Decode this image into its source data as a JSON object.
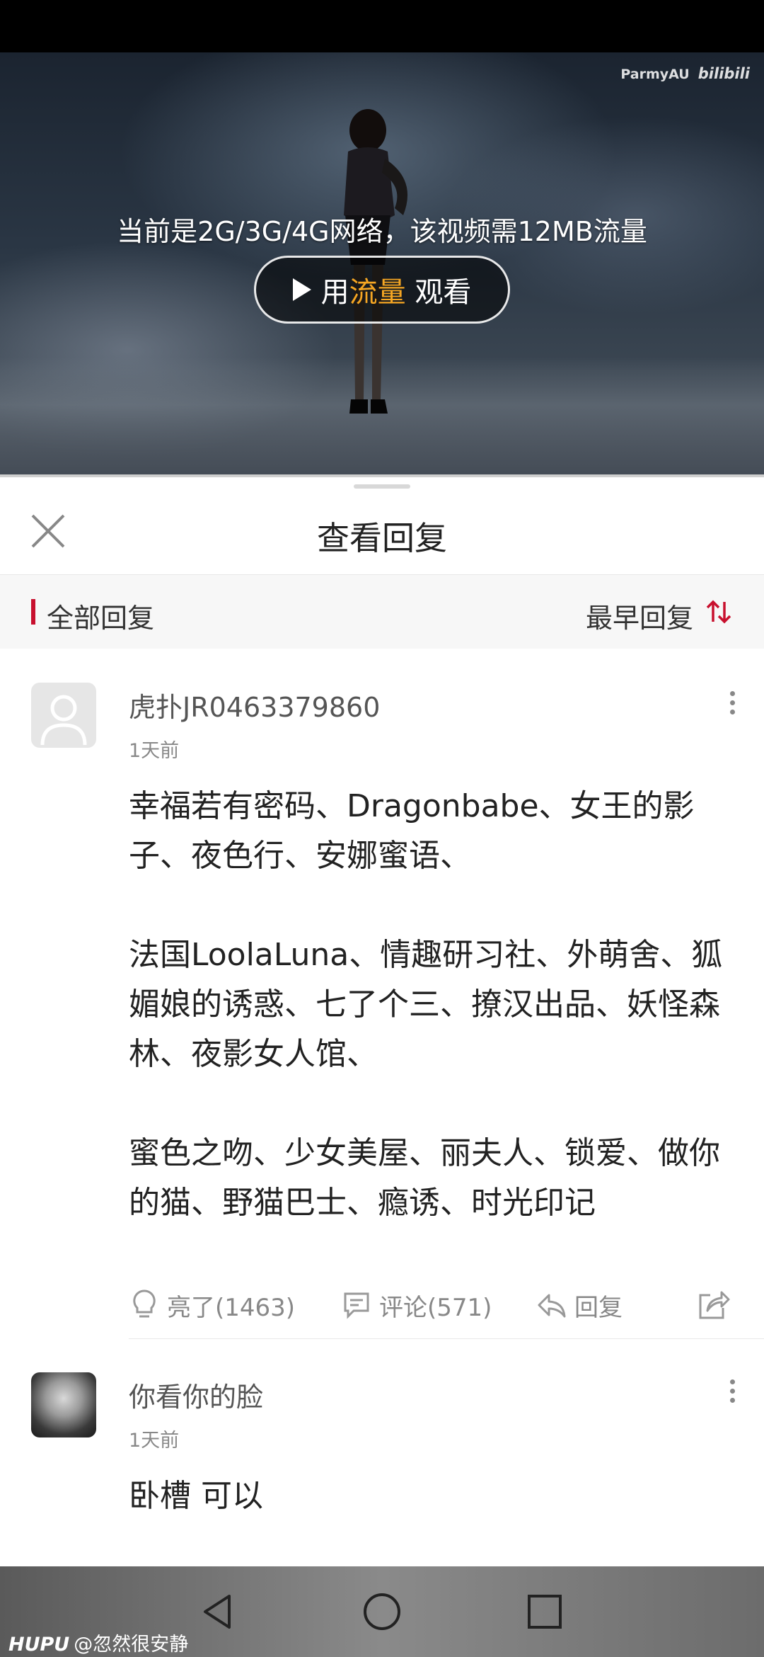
{
  "video": {
    "watermark_user": "ParmyAU",
    "watermark_logo": "bilibili",
    "notice": "当前是2G/3G/4G网络，该视频需12MB流量",
    "play_button": {
      "prefix": "用",
      "accent": "流量",
      "suffix": " 观看"
    }
  },
  "header": {
    "title": "查看回复",
    "close_icon": "close-icon"
  },
  "filter": {
    "all_label": "全部回复",
    "sort_label": "最早回复",
    "sort_icon": "sort-icon"
  },
  "comments": [
    {
      "username": "虎扑JR0463379860",
      "time": "1天前",
      "content": "幸福若有密码、Dragonbabe、女王的影子、夜色行、安娜蜜语、\n\n法国LoolaLuna、情趣研习社、外萌舍、狐媚娘的诱惑、七了个三、撩汉出品、妖怪森林、夜影女人馆、\n\n蜜色之吻、少女美屋、丽夫人、锁爱、做你的猫、野猫巴士、瘾诱、时光印记",
      "actions": {
        "like": "亮了(1463)",
        "comment": "评论(571)",
        "reply": "回复"
      }
    },
    {
      "username": "你看你的脸",
      "time": "1天前",
      "content": "卧槽 可以"
    }
  ],
  "footer": {
    "brand": "HUPU",
    "handle": "@忽然很安静"
  },
  "colors": {
    "accent": "#c8102e",
    "flow": "#f5a623"
  }
}
